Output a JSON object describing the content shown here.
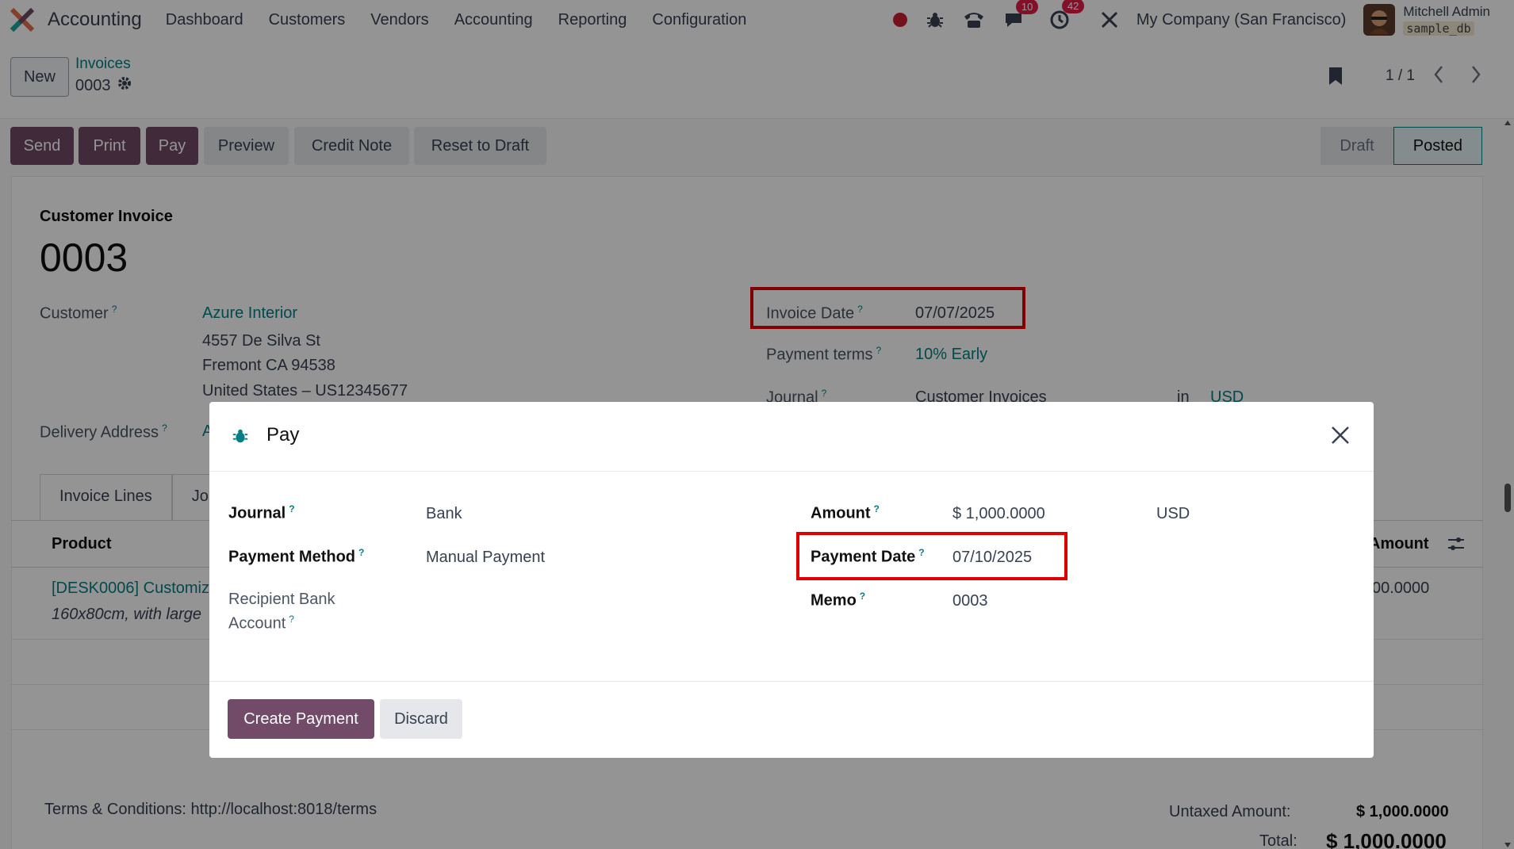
{
  "topnav": {
    "app_name": "Accounting",
    "menu": [
      "Dashboard",
      "Customers",
      "Vendors",
      "Accounting",
      "Reporting",
      "Configuration"
    ],
    "messages_count": "10",
    "activities_count": "42",
    "company": "My Company (San Francisco)",
    "user_name": "Mitchell Admin",
    "db_name": "sample_db"
  },
  "control_panel": {
    "new_label": "New",
    "breadcrumb_parent": "Invoices",
    "breadcrumb_current": "0003",
    "pager": "1 / 1"
  },
  "actions": {
    "send": "Send",
    "print": "Print",
    "pay": "Pay",
    "preview": "Preview",
    "credit_note": "Credit Note",
    "reset_to_draft": "Reset to Draft"
  },
  "status": {
    "draft": "Draft",
    "posted": "Posted"
  },
  "invoice": {
    "type": "Customer Invoice",
    "number": "0003",
    "customer_label": "Customer",
    "customer_name": "Azure Interior",
    "address_line1": "4557 De Silva St",
    "address_line2": "Fremont CA 94538",
    "address_line3": "United States – US12345677",
    "delivery_label": "Delivery Address",
    "delivery_value": "A",
    "invoice_date_label": "Invoice Date",
    "invoice_date": "07/07/2025",
    "payment_terms_label": "Payment terms",
    "payment_terms": "10% Early",
    "journal_label": "Journal",
    "journal_value": "Customer Invoices",
    "journal_in": "in",
    "currency": "USD"
  },
  "tabs": {
    "invoice_lines": "Invoice Lines",
    "journal_items": "Jo"
  },
  "lines": {
    "product_header": "Product",
    "amount_header": "Amount",
    "product": "[DESK0006] Customiz",
    "description": "160x80cm, with large",
    "amount": "00.0000"
  },
  "footer": {
    "terms": "Terms & Conditions: http://localhost:8018/terms",
    "untaxed_label": "Untaxed Amount:",
    "untaxed_value": "$ 1,000.0000",
    "total_label": "Total:",
    "total_value": "$ 1,000.0000"
  },
  "modal": {
    "title": "Pay",
    "journal_label": "Journal",
    "journal_value": "Bank",
    "payment_method_label": "Payment Method",
    "payment_method_value": "Manual Payment",
    "recipient_label_1": "Recipient Bank",
    "recipient_label_2": "Account",
    "amount_label": "Amount",
    "amount_value": "$ 1,000.0000",
    "amount_currency": "USD",
    "payment_date_label": "Payment Date",
    "payment_date_value": "07/10/2025",
    "memo_label": "Memo",
    "memo_value": "0003",
    "create_payment": "Create Payment",
    "discard": "Discard"
  },
  "colors": {
    "primary": "#714b67",
    "link": "#017e84",
    "highlight": "#e00000"
  },
  "icons": [
    "bug-icon",
    "phone-icon",
    "chat-icon",
    "clock-icon",
    "tools-icon",
    "gear-icon",
    "bookmark-icon",
    "close-icon"
  ]
}
